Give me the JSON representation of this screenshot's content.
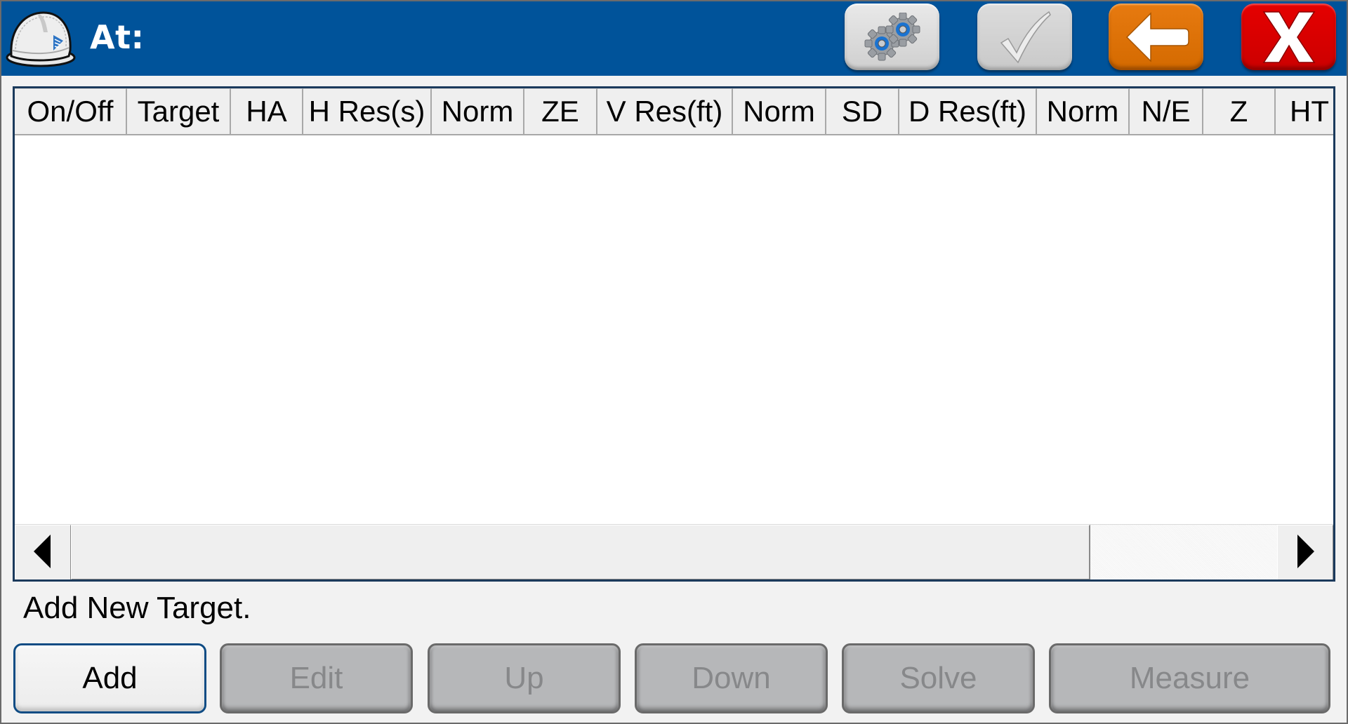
{
  "header": {
    "title": "At:",
    "app_icon": "hard-hat-icon",
    "buttons": [
      {
        "name": "settings",
        "icon": "gears-icon",
        "color": "#d9d9d9"
      },
      {
        "name": "accept",
        "icon": "checkmark-icon",
        "color": "#d0d0d0",
        "enabled": false
      },
      {
        "name": "back",
        "icon": "arrow-left-icon",
        "color": "#dd7000"
      },
      {
        "name": "close",
        "icon": "x-icon",
        "color": "#dd0000"
      }
    ],
    "background_color": "#00539a"
  },
  "table": {
    "columns": [
      "On/Off",
      "Target",
      "HA",
      "H Res(s)",
      "Norm",
      "ZE",
      "V Res(ft)",
      "Norm",
      "SD",
      "D Res(ft)",
      "Norm",
      "N/E",
      "Z",
      "HT"
    ],
    "rows": [],
    "horizontal_scroll": {
      "position_fraction": 0.0,
      "visible_fraction": 0.845
    }
  },
  "status": {
    "message": "Add New Target."
  },
  "actions": [
    {
      "label": "Add",
      "enabled": true
    },
    {
      "label": "Edit",
      "enabled": false
    },
    {
      "label": "Up",
      "enabled": false
    },
    {
      "label": "Down",
      "enabled": false
    },
    {
      "label": "Solve",
      "enabled": false
    },
    {
      "label": "Measure",
      "enabled": false
    }
  ]
}
